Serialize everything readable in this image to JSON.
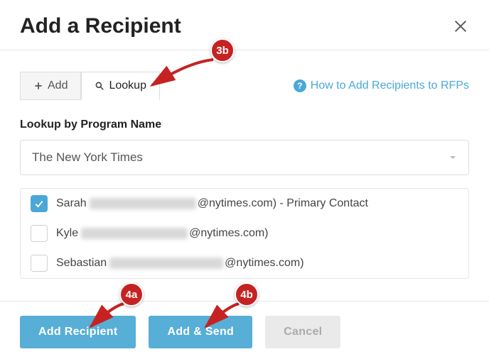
{
  "header": {
    "title": "Add a Recipient"
  },
  "tabs": {
    "add_label": "Add",
    "lookup_label": "Lookup"
  },
  "help_link": "How to Add Recipients to RFPs",
  "lookup": {
    "label": "Lookup by Program Name",
    "selected": "The New York Times"
  },
  "contacts": [
    {
      "first": "Sarah",
      "email_suffix": "@nytimes.com)",
      "tail": " - Primary Contact",
      "checked": true,
      "blur_w": 150
    },
    {
      "first": "Kyle",
      "email_suffix": "@nytimes.com)",
      "tail": "",
      "checked": false,
      "blur_w": 150
    },
    {
      "first": "Sebastian",
      "email_suffix": "@nytimes.com)",
      "tail": "",
      "checked": false,
      "blur_w": 160
    }
  ],
  "footer": {
    "add_recipient": "Add Recipient",
    "add_send": "Add & Send",
    "cancel": "Cancel"
  },
  "annotations": {
    "b3b": "3b",
    "b4a": "4a",
    "b4b": "4b"
  }
}
